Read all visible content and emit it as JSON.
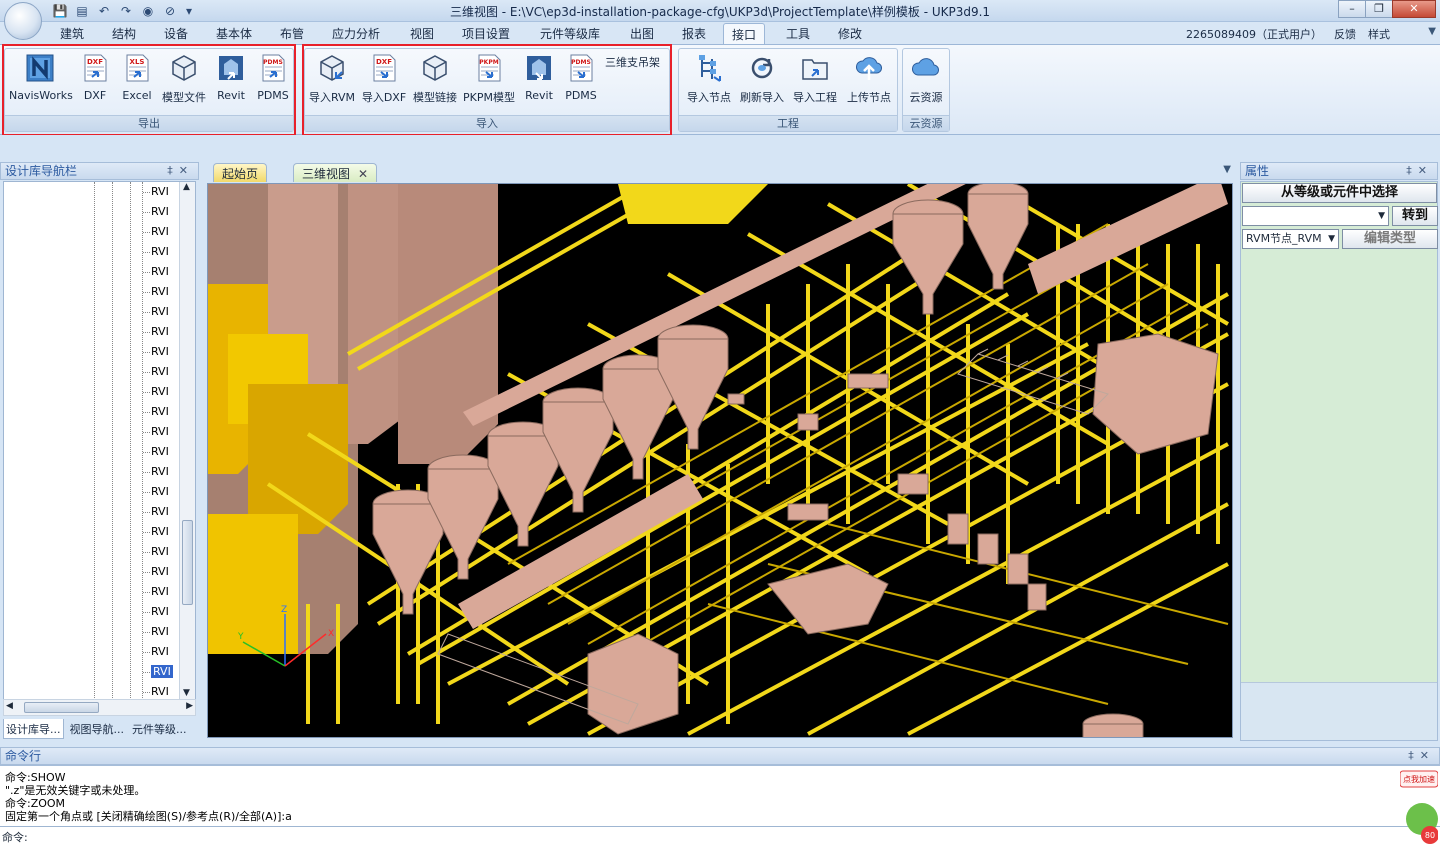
{
  "window": {
    "title": "三维视图 - E:\\VC\\ep3d-installation-package-cfg\\UKP3d\\ProjectTemplate\\样例模板 - UKP3d9.1"
  },
  "menu": {
    "tabs": [
      "建筑",
      "结构",
      "设备",
      "基本体",
      "布管",
      "应力分析",
      "视图",
      "项目设置",
      "元件等级库",
      "出图",
      "报表",
      "接口",
      "工具",
      "修改"
    ],
    "active_tab": "接口",
    "user": "2265089409（正式用户）",
    "feedback": "反馈",
    "style": "样式"
  },
  "ribbon": {
    "export": {
      "caption": "导出",
      "buttons": [
        "NavisWorks",
        "DXF",
        "Excel",
        "模型文件",
        "Revit",
        "PDMS"
      ]
    },
    "import": {
      "caption": "导入",
      "buttons": [
        "导入RVM",
        "导入DXF",
        "模型链接",
        "PKPM模型",
        "Revit",
        "PDMS"
      ],
      "extra": "三维支吊架"
    },
    "project": {
      "caption": "工程",
      "buttons": [
        "导入节点",
        "刷新导入",
        "导入工程",
        "上传节点"
      ]
    },
    "cloud": {
      "caption": "云资源",
      "buttons": [
        "云资源"
      ]
    },
    "icon_text": {
      "dxf": "DXF",
      "xls": "XLS",
      "pdms": "PDMS",
      "pkpm": "PKPM"
    }
  },
  "nav_panel": {
    "title": "设计库导航栏",
    "items": [
      "RVI",
      "RVI",
      "RVI",
      "RVI",
      "RVI",
      "RVI",
      "RVI",
      "RVI",
      "RVI",
      "RVI",
      "RVI",
      "RVI",
      "RVI",
      "RVI",
      "RVI",
      "RVI",
      "RVI",
      "RVI",
      "RVI",
      "RVI",
      "RVI",
      "RVI",
      "RVI",
      "RVI",
      "RVI",
      "RVI"
    ],
    "selected_index": 24,
    "bottom_tabs": [
      "设计库导...",
      "视图导航...",
      "元件等级..."
    ]
  },
  "doc_tabs": [
    "起始页",
    "三维视图"
  ],
  "axes": {
    "x": "X",
    "y": "Y",
    "z": "Z"
  },
  "props": {
    "title": "属性",
    "select_button": "从等级或元件中选择",
    "goto_button": "转到",
    "combo_value": "",
    "node_combo": "RVM节点_RVM",
    "edit_type": "编辑类型"
  },
  "command": {
    "title": "命令行",
    "history": [
      "命令:SHOW",
      "\".z\"是无效关键字或未处理。",
      "命令:ZOOM",
      "固定第一个角点或 [关闭精确绘图(S)/参考点(R)/全部(A)]:a"
    ],
    "prompt": "命令:",
    "input_value": ""
  },
  "badge": {
    "label": "点我加速",
    "value": "80"
  },
  "colors": {
    "pipe_yellow": "#f2d81a",
    "equipment_tan": "#d9a898",
    "viewport_bg": "#000000",
    "highlight_red": "#e8202a"
  }
}
